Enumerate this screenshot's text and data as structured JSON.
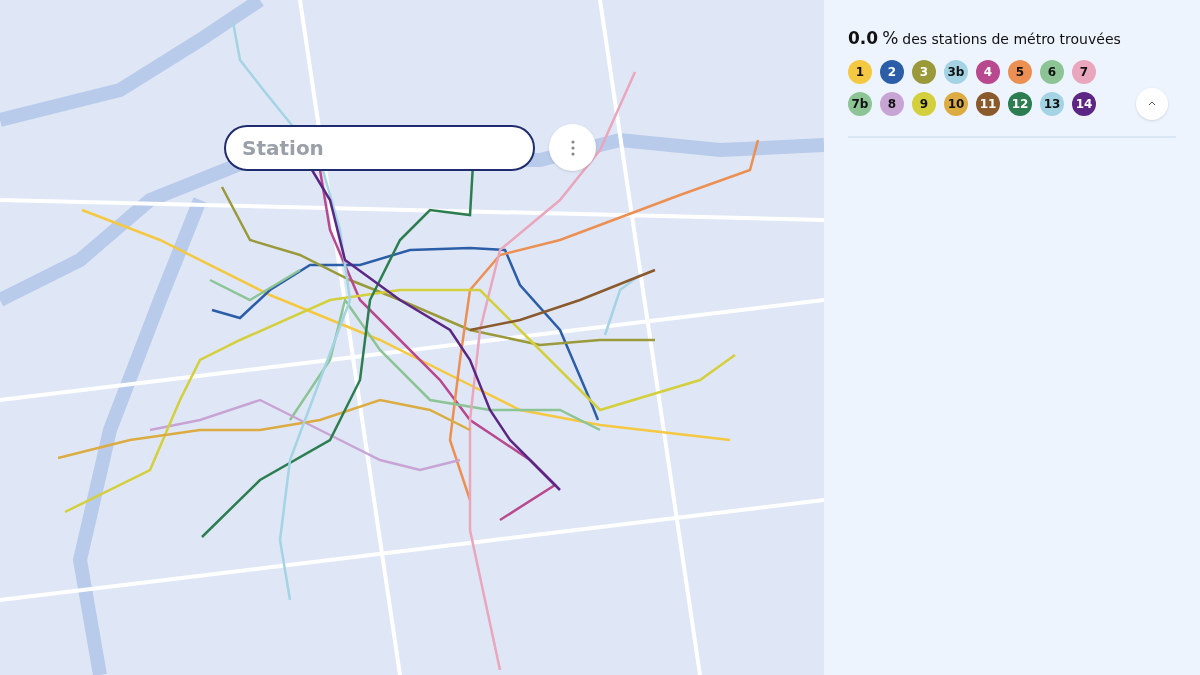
{
  "search": {
    "placeholder": "Station"
  },
  "progress": {
    "value": "0.0",
    "unit": "%",
    "text": "des stations de métro trouvées"
  },
  "lines": [
    {
      "label": "1",
      "color": "#f5c842"
    },
    {
      "label": "2",
      "color": "#2c5ea8"
    },
    {
      "label": "3",
      "color": "#9a9a3a"
    },
    {
      "label": "3b",
      "color": "#a4d4e4"
    },
    {
      "label": "4",
      "color": "#b8498f"
    },
    {
      "label": "5",
      "color": "#ec8f52"
    },
    {
      "label": "6",
      "color": "#8cc496"
    },
    {
      "label": "7",
      "color": "#eaa6bc"
    },
    {
      "label": "7b",
      "color": "#8cc496"
    },
    {
      "label": "8",
      "color": "#c8a4d4"
    },
    {
      "label": "9",
      "color": "#d4cf3c"
    },
    {
      "label": "10",
      "color": "#dcac42"
    },
    {
      "label": "11",
      "color": "#8a5a2c"
    },
    {
      "label": "12",
      "color": "#2c7d50"
    },
    {
      "label": "13",
      "color": "#a4d4e4"
    },
    {
      "label": "14",
      "color": "#5c2684"
    }
  ]
}
